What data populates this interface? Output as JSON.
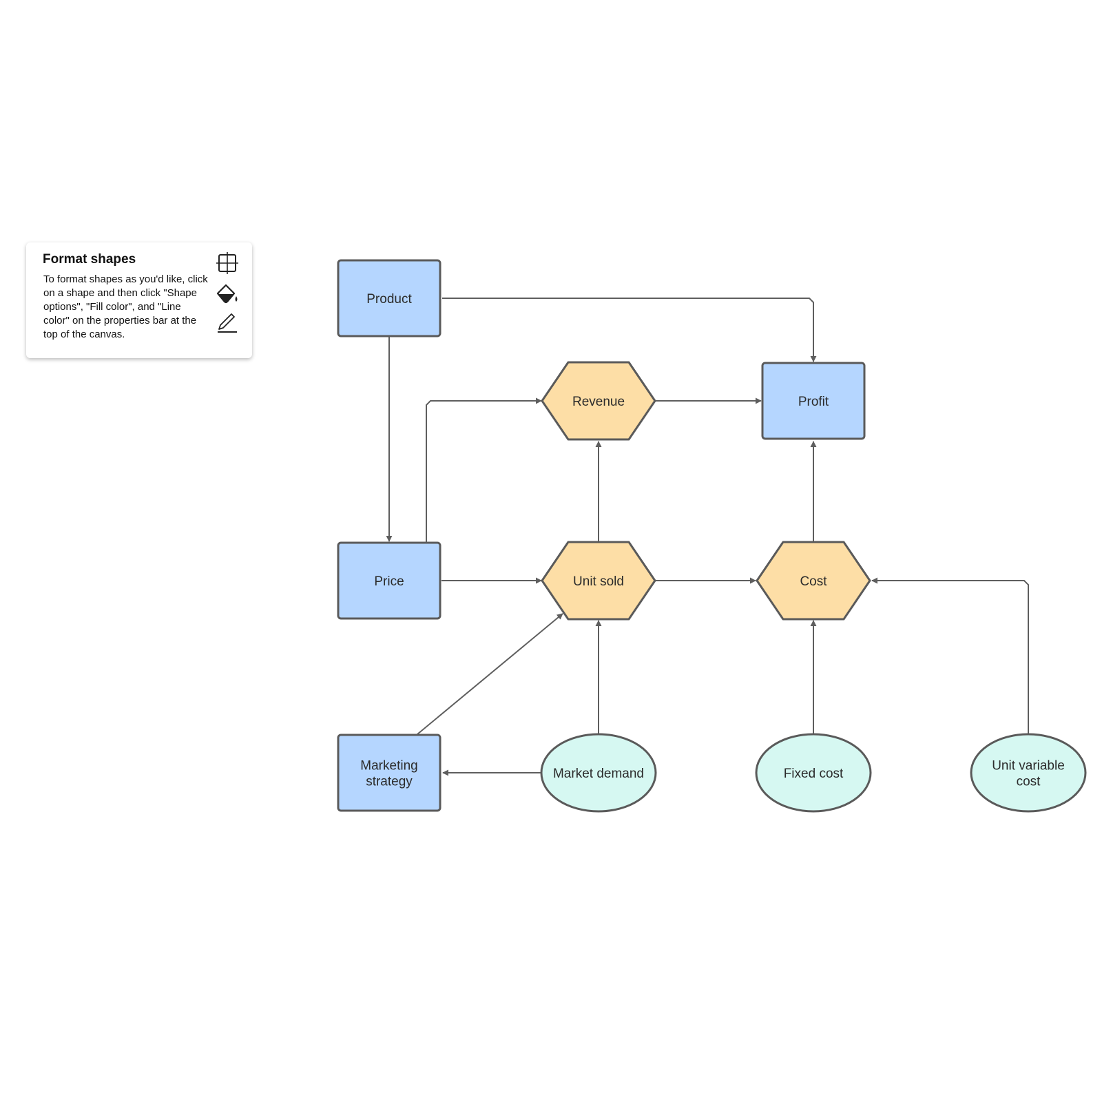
{
  "colors": {
    "rect_fill": "#b5d6ff",
    "hex_fill": "#fddea6",
    "ellipse_fill": "#d6f8f2",
    "stroke": "#5a5a5a",
    "edge": "#5e5e5e"
  },
  "info_card": {
    "title": "Format shapes",
    "body": "To format shapes as you'd like, click on a shape and then click \"Shape options\", \"Fill color\", and \"Line color\" on the properties bar at the top of the canvas.",
    "icons": [
      "shape-options-icon",
      "fill-color-icon",
      "line-color-icon"
    ]
  },
  "nodes": {
    "product": {
      "label": [
        "Product"
      ],
      "shape": "rect"
    },
    "profit": {
      "label": [
        "Profit"
      ],
      "shape": "rect"
    },
    "price": {
      "label": [
        "Price"
      ],
      "shape": "rect"
    },
    "marketing": {
      "label": [
        "Marketing",
        "strategy"
      ],
      "shape": "rect"
    },
    "revenue": {
      "label": [
        "Revenue"
      ],
      "shape": "hexagon"
    },
    "unit_sold": {
      "label": [
        "Unit sold"
      ],
      "shape": "hexagon"
    },
    "cost": {
      "label": [
        "Cost"
      ],
      "shape": "hexagon"
    },
    "market_demand": {
      "label": [
        "Market demand"
      ],
      "shape": "ellipse"
    },
    "fixed_cost": {
      "label": [
        "Fixed cost"
      ],
      "shape": "ellipse"
    },
    "unit_variable_cost": {
      "label": [
        "Unit variable",
        "cost"
      ],
      "shape": "ellipse"
    }
  },
  "edges": [
    {
      "from": "product",
      "to": "profit"
    },
    {
      "from": "product",
      "to": "price"
    },
    {
      "from": "price",
      "to": "revenue"
    },
    {
      "from": "revenue",
      "to": "profit"
    },
    {
      "from": "unit_sold",
      "to": "revenue"
    },
    {
      "from": "cost",
      "to": "profit"
    },
    {
      "from": "price",
      "to": "unit_sold"
    },
    {
      "from": "unit_sold",
      "to": "cost"
    },
    {
      "from": "unit_variable_cost",
      "to": "cost"
    },
    {
      "from": "marketing",
      "to": "unit_sold"
    },
    {
      "from": "market_demand",
      "to": "unit_sold"
    },
    {
      "from": "fixed_cost",
      "to": "cost"
    },
    {
      "from": "market_demand",
      "to": "marketing"
    }
  ]
}
